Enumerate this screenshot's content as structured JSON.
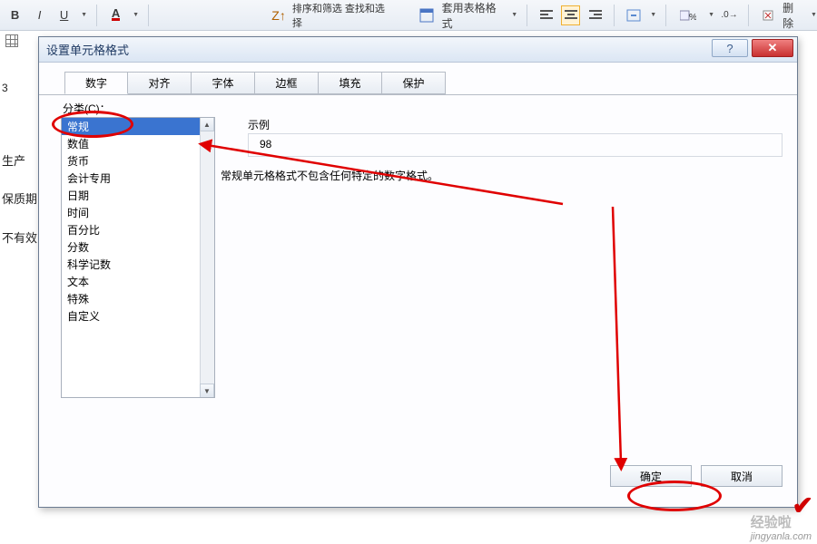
{
  "ribbon": {
    "bold": "B",
    "italic": "I",
    "underline": "U",
    "sort_filter": "排序和筛选  查找和选择",
    "table_format": "套用表格格式",
    "delete": "删除"
  },
  "sheet": {
    "cell_ref": "3",
    "rows": [
      "生产",
      "保质期",
      "不有效"
    ]
  },
  "dialog": {
    "title": "设置单元格格式",
    "tabs": [
      "数字",
      "对齐",
      "字体",
      "边框",
      "填充",
      "保护"
    ],
    "category_label": "分类(C)：",
    "categories": [
      "常规",
      "数值",
      "货币",
      "会计专用",
      "日期",
      "时间",
      "百分比",
      "分数",
      "科学记数",
      "文本",
      "特殊",
      "自定义"
    ],
    "example_label": "示例",
    "example_value": "98",
    "description": "常规单元格格式不包含任何特定的数字格式。",
    "ok": "确定",
    "cancel": "取消"
  },
  "watermark": {
    "brand": "经验啦",
    "url": "jingyanla.com"
  }
}
